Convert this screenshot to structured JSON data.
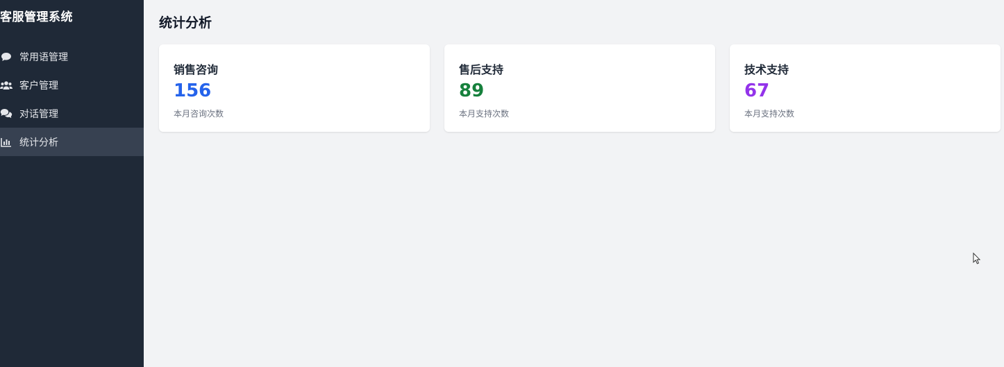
{
  "sidebar": {
    "title": "客服管理系统",
    "items": [
      {
        "label": "常用语管理",
        "icon": "comment-icon"
      },
      {
        "label": "客户管理",
        "icon": "users-icon"
      },
      {
        "label": "对话管理",
        "icon": "comments-icon"
      },
      {
        "label": "统计分析",
        "icon": "bar-chart-icon",
        "active": true
      }
    ]
  },
  "main": {
    "title": "统计分析",
    "cards": [
      {
        "title": "销售咨询",
        "value": "156",
        "desc": "本月咨询次数",
        "color": "#2563eb"
      },
      {
        "title": "售后支持",
        "value": "89",
        "desc": "本月支持次数",
        "color": "#16803c"
      },
      {
        "title": "技术支持",
        "value": "67",
        "desc": "本月支持次数",
        "color": "#9333ea"
      }
    ]
  },
  "colors": {
    "sidebar_bg": "#1f2937",
    "active_item_bg": "#374151",
    "page_bg": "#f2f3f5"
  }
}
